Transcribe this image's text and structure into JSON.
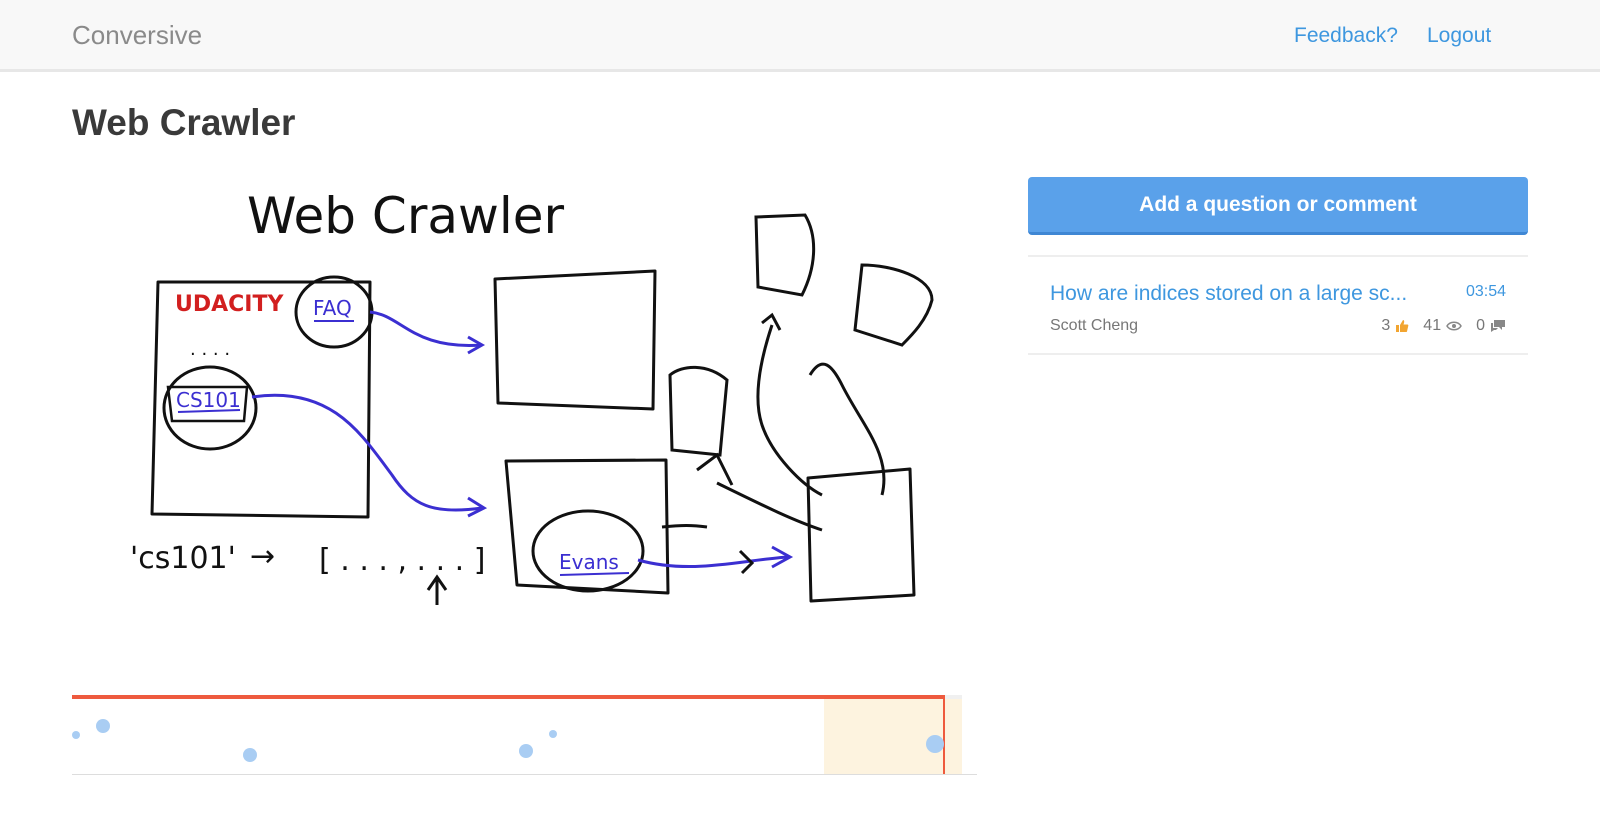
{
  "app": {
    "brand": "Conversive"
  },
  "nav": {
    "feedback": "Feedback?",
    "logout": "Logout"
  },
  "page": {
    "title": "Web Crawler"
  },
  "whiteboard": {
    "heading": "Web Crawler",
    "brand_label": "UDACITY",
    "faq_label": "FAQ",
    "dots": ". . . .",
    "course_label": "CS101",
    "mapping_key": "'cs101'",
    "mapping_arrow": "→",
    "mapping_list": "[ . . . ,   . . . ]",
    "evans_label": "Evans"
  },
  "timeline": {
    "progress": 0.98,
    "highlight_start": 0.845,
    "highlight_end": 1.0,
    "markers": [
      {
        "pos": 0.005,
        "level": 0.5,
        "size": "small"
      },
      {
        "pos": 0.035,
        "level": 0.38,
        "size": "medium"
      },
      {
        "pos": 0.2,
        "level": 0.78,
        "size": "medium"
      },
      {
        "pos": 0.51,
        "level": 0.72,
        "size": "medium"
      },
      {
        "pos": 0.54,
        "level": 0.48,
        "size": "small"
      },
      {
        "pos": 0.97,
        "level": 0.62,
        "size": "large"
      }
    ],
    "colors": {
      "progress": "#ee5a3e",
      "marker": "#a9cdf3",
      "highlight": "#fdf3df"
    }
  },
  "sidebar": {
    "add_button": "Add a question or comment",
    "questions": [
      {
        "title": "How are indices stored on a large sc...",
        "time": "03:54",
        "author": "Scott Cheng",
        "likes": "3",
        "views": "41",
        "comments": "0",
        "icons": {
          "likes": "thumbs-up-icon",
          "views": "eye-icon",
          "comments": "comments-icon"
        }
      }
    ]
  },
  "colors": {
    "accent": "#3e97df",
    "button": "#5aa1ea",
    "navbar": "#f8f8f8"
  }
}
